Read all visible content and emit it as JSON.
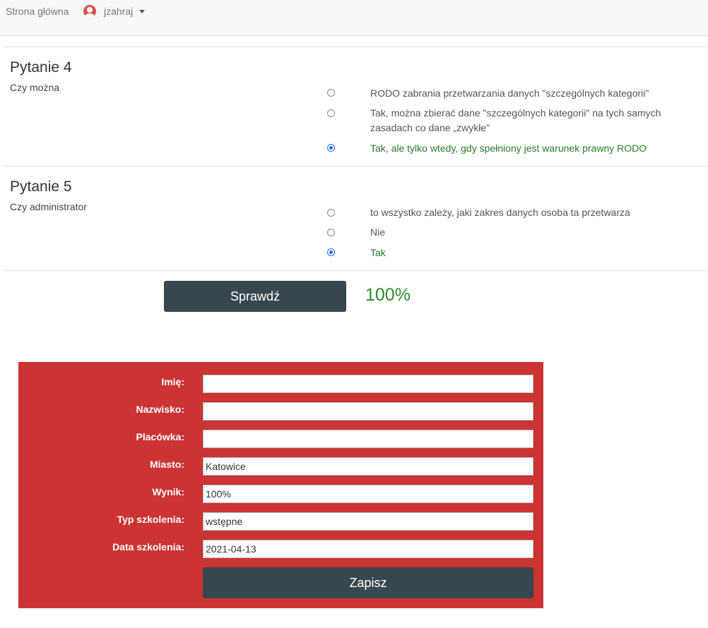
{
  "nav": {
    "home": "Strona główna",
    "user": "jzahraj",
    "avatar_icon": "user-circle-icon",
    "caret_icon": "caret-down-icon"
  },
  "questions": [
    {
      "title": "Pytanie 4",
      "text": "Czy można",
      "answers": [
        {
          "label": "RODO zabrania przetwarzania danych \"szczególnych kategorii\"",
          "checked": false,
          "correct": false
        },
        {
          "label": "Tak, można zbierać dane \"szczególnych kategorii\" na tych samych zasadach co dane „zwykłe”",
          "checked": false,
          "correct": false
        },
        {
          "label": "Tak, ale tylko wtedy, gdy spełniony jest warunek prawny RODO",
          "checked": true,
          "correct": true
        }
      ]
    },
    {
      "title": "Pytanie 5",
      "text": "Czy administrator",
      "answers": [
        {
          "label": "to wszystko zależy, jaki zakres danych osoba ta przetwarza",
          "checked": false,
          "correct": false
        },
        {
          "label": "Nie",
          "checked": false,
          "correct": false
        },
        {
          "label": "Tak",
          "checked": true,
          "correct": true
        }
      ]
    }
  ],
  "check_button": "Sprawdź",
  "score": "100%",
  "form": {
    "fields": [
      {
        "label": "Imię:",
        "value": ""
      },
      {
        "label": "Nazwisko:",
        "value": ""
      },
      {
        "label": "Placówka:",
        "value": ""
      },
      {
        "label": "Miasto:",
        "value": "Katowice"
      },
      {
        "label": "Wynik:",
        "value": "100%"
      },
      {
        "label": "Typ szkolenia:",
        "value": "wstępne"
      },
      {
        "label": "Data szkolenia:",
        "value": "2021-04-13"
      }
    ],
    "save_button": "Zapisz"
  },
  "colors": {
    "panel": "#cc3333",
    "button": "#37474f",
    "correct_text": "#2a7a2a",
    "score": "#2e8b2e"
  }
}
